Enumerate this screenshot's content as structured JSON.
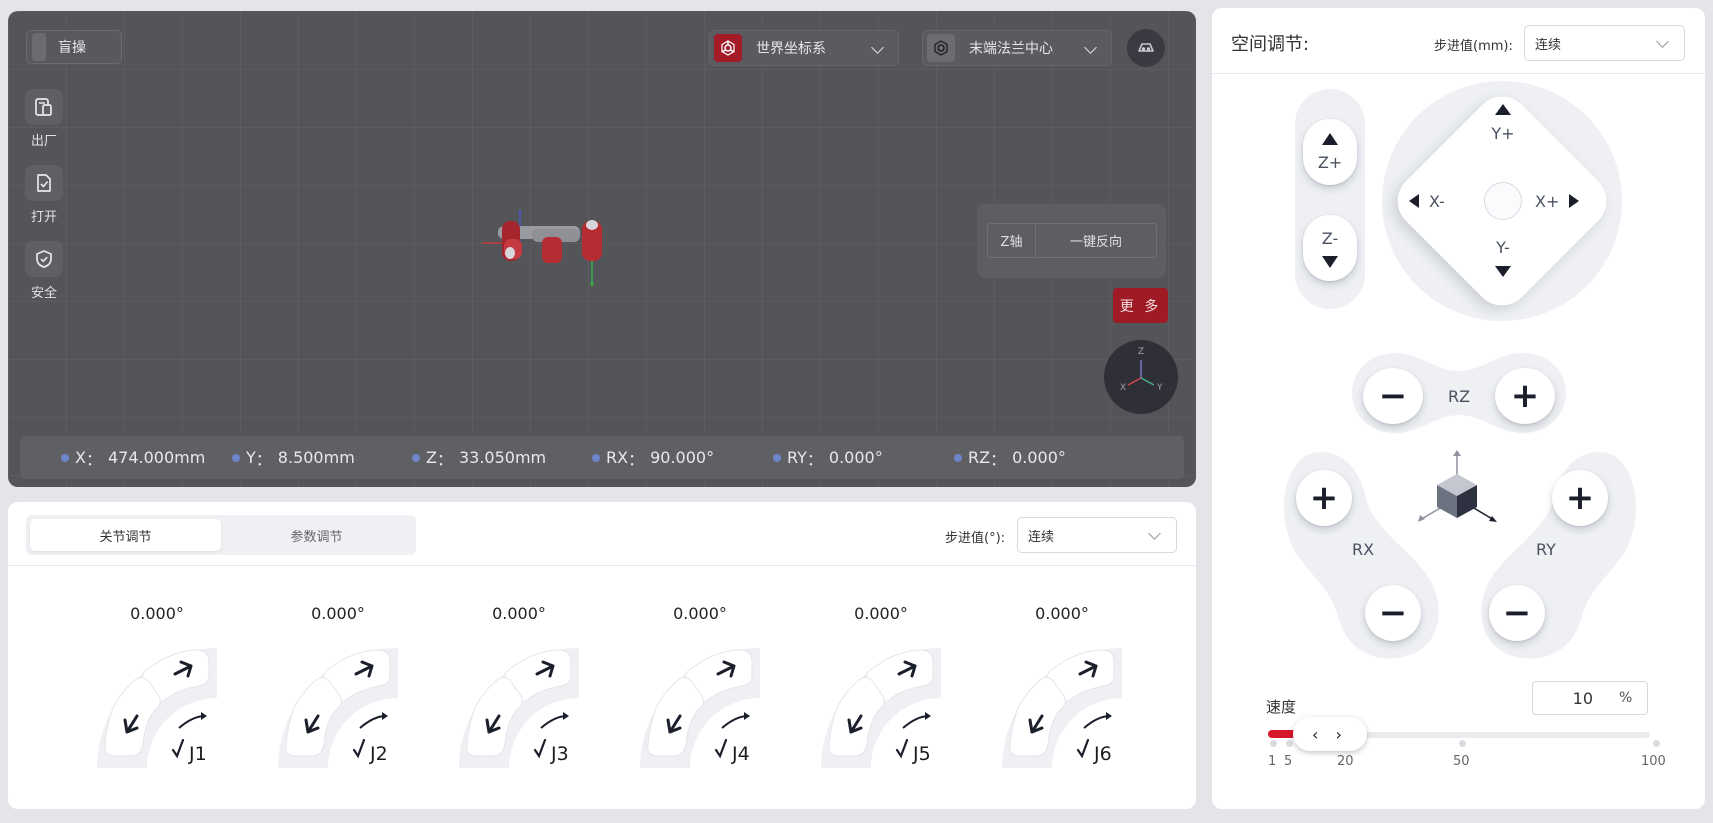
{
  "viewport": {
    "blind_label": "盲操",
    "tools": [
      {
        "label": "出厂",
        "icon": "factory-icon"
      },
      {
        "label": "打开",
        "icon": "open-file-icon"
      },
      {
        "label": "安全",
        "icon": "shield-icon"
      }
    ],
    "coord_system": "世界坐标系",
    "tool_frame": "末端法兰中心",
    "zaxis_label": "Z轴",
    "reverse_label": "一键反向",
    "more_label": "更 多",
    "gizmo_axes": {
      "z": "Z",
      "x": "X",
      "y": "Y"
    },
    "coords": [
      {
        "label": "X",
        "value": "474.000mm"
      },
      {
        "label": "Y",
        "value": "8.500mm"
      },
      {
        "label": "Z",
        "value": "33.050mm"
      },
      {
        "label": "RX",
        "value": "90.000°"
      },
      {
        "label": "RY",
        "value": "0.000°"
      },
      {
        "label": "RZ",
        "value": "0.000°"
      }
    ]
  },
  "joint_panel": {
    "tabs": [
      "关节调节",
      "参数调节"
    ],
    "active_tab": 0,
    "step_label": "步进值(°):",
    "step_value": "连续",
    "joints": [
      {
        "name": "J1",
        "value": "0.000°"
      },
      {
        "name": "J2",
        "value": "0.000°"
      },
      {
        "name": "J3",
        "value": "0.000°"
      },
      {
        "name": "J4",
        "value": "0.000°"
      },
      {
        "name": "J5",
        "value": "0.000°"
      },
      {
        "name": "J6",
        "value": "0.000°"
      }
    ]
  },
  "space_panel": {
    "title": "空间调节:",
    "step_label": "步进值(mm):",
    "step_value": "连续",
    "labels": {
      "zplus": "Z+",
      "zminus": "Z-",
      "yplus": "Y+",
      "yminus": "Y-",
      "xplus": "X+",
      "xminus": "X-",
      "rz": "RZ",
      "rx": "RX",
      "ry": "RY"
    },
    "speed_label": "速度",
    "speed_value": "10",
    "speed_unit": "%",
    "speed_fraction": 0.1,
    "speed_ticks": [
      "1",
      "5",
      "20",
      "50",
      "100"
    ],
    "thumb_glyph": "‹ ›"
  },
  "colors": {
    "accent": "#d7172a",
    "panel": "#ffffff",
    "viewport": "#545559"
  }
}
